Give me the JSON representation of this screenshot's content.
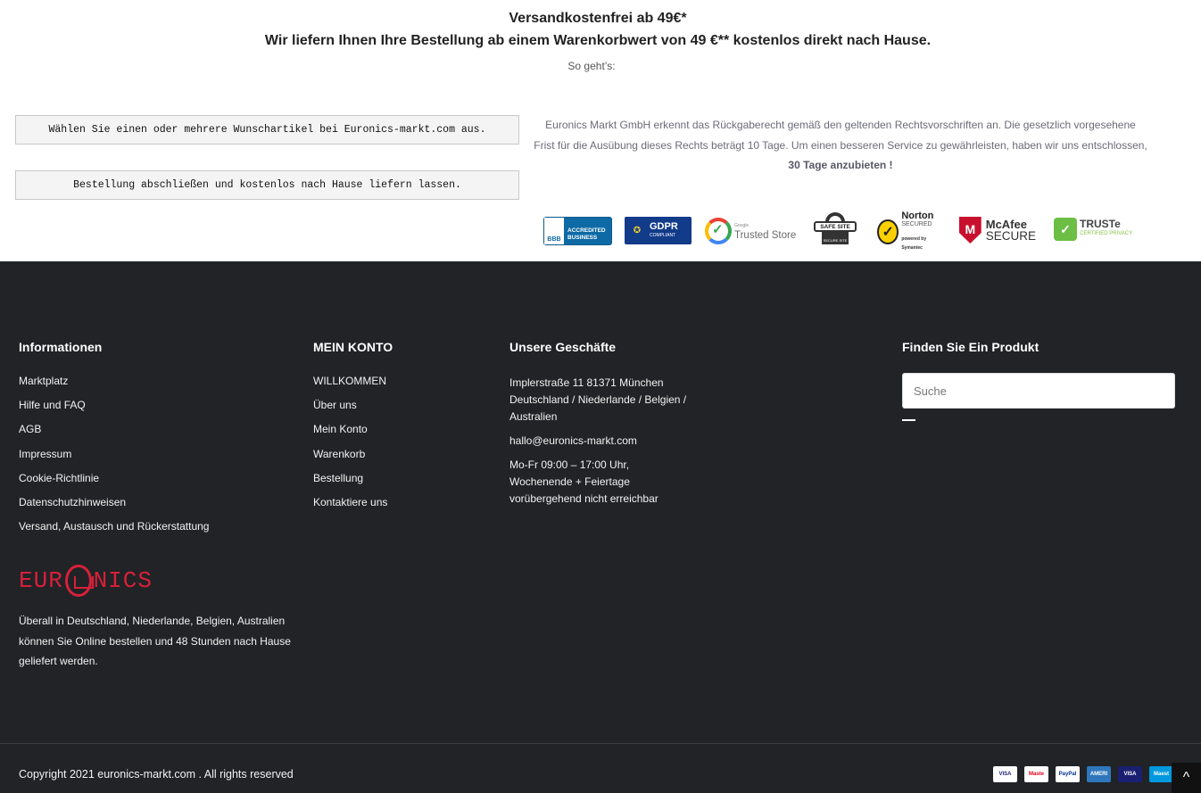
{
  "header": {
    "headline1": "Versandkostenfrei ab 49€*",
    "headline2": "Wir liefern Ihnen Ihre Bestellung ab einem Warenkorbwert von 49 €** kostenlos direkt nach Hause.",
    "howto": "So geht’s:"
  },
  "steps": [
    "Wählen Sie einen oder mehrere Wunschartikel bei Euronics-markt.com aus.",
    "Bestellung abschließen und kostenlos nach Hause liefern lassen."
  ],
  "policy": {
    "text": "Euronics Markt GmbH erkennt das Rückgaberecht gemäß den geltenden Rechtsvorschriften an. Die gesetzlich vorgesehene Frist für die Ausübung dieses Rechts beträgt 10 Tage. Um einen besseren Service zu gewährleisten, haben wir uns entschlossen, ",
    "highlight": "30 Tage anzubieten !"
  },
  "trust_badges": {
    "bbb": {
      "mark": "BBB",
      "line1": "ACCREDITED",
      "line2": "BUSINESS"
    },
    "gdpr": {
      "title": "GDPR",
      "sub": "COMPLIANT"
    },
    "google": {
      "small": "Google",
      "title": "Trusted Store"
    },
    "safe": {
      "title": "SAFE SITE",
      "sub": "SECURE SITE"
    },
    "norton": {
      "title": "Norton",
      "sub": "SECURED",
      "by": "powered by Symantec"
    },
    "mcafee": {
      "title": "McAfee",
      "sub": "SECURE"
    },
    "truste": {
      "title": "TRUSTe",
      "sub": "CERTIFIED PRIVACY"
    }
  },
  "footer": {
    "info": {
      "title": "Informationen",
      "links": [
        "Marktplatz",
        "Hilfe und FAQ",
        "AGB",
        "Impressum",
        "Cookie-Richtlinie",
        "Datenschutzhinweisen",
        "Versand, Austausch und Rückerstattung"
      ]
    },
    "account": {
      "title": "MEIN KONTO",
      "links": [
        "WILLKOMMEN",
        "Über uns",
        "Mein Konto",
        "Warenkorb",
        "Bestellung",
        "Kontaktiere uns"
      ]
    },
    "shops": {
      "title": "Unsere Geschäfte",
      "address": "Implerstraße 11 81371 München Deutschland / Niederlande / Belgien / Australien",
      "email": "hallo@euronics-markt.com",
      "hours": "Mo-Fr 09:00 – 17:00 Uhr, Wochenende + Feiertage vorübergehend nicht erreichbar"
    },
    "find": {
      "title": "Finden Sie Ein Produkt",
      "search_placeholder": "Suche",
      "search_value": ""
    },
    "logo": {
      "part1": "EUR",
      "part2": "NICS"
    },
    "about": "Überall in Deutschland, Niederlande, Belgien, Australien können Sie Online bestellen und 48 Stunden nach Hause geliefert werden.",
    "copyright": "Copyright 2021 euronics-markt.com . All rights reserved",
    "payments": [
      {
        "name": "VISA",
        "bg": "#ffffff",
        "fg": "#1a1f71"
      },
      {
        "name": "MasterCard",
        "bg": "#ffffff",
        "fg": "#eb001b"
      },
      {
        "name": "PayPal",
        "bg": "#ffffff",
        "fg": "#003087"
      },
      {
        "name": "AMERICAN EXPRESS",
        "bg": "#2e77bc",
        "fg": "#ffffff"
      },
      {
        "name": "VISA Electron",
        "bg": "#1a1f71",
        "fg": "#ffffff"
      },
      {
        "name": "Maestro",
        "bg": "#0099df",
        "fg": "#ffffff"
      }
    ],
    "to_top": "^"
  },
  "colors": {
    "footer_bg": "#212326",
    "brand_red": "#d8203a",
    "policy_text": "#6b6b78"
  }
}
